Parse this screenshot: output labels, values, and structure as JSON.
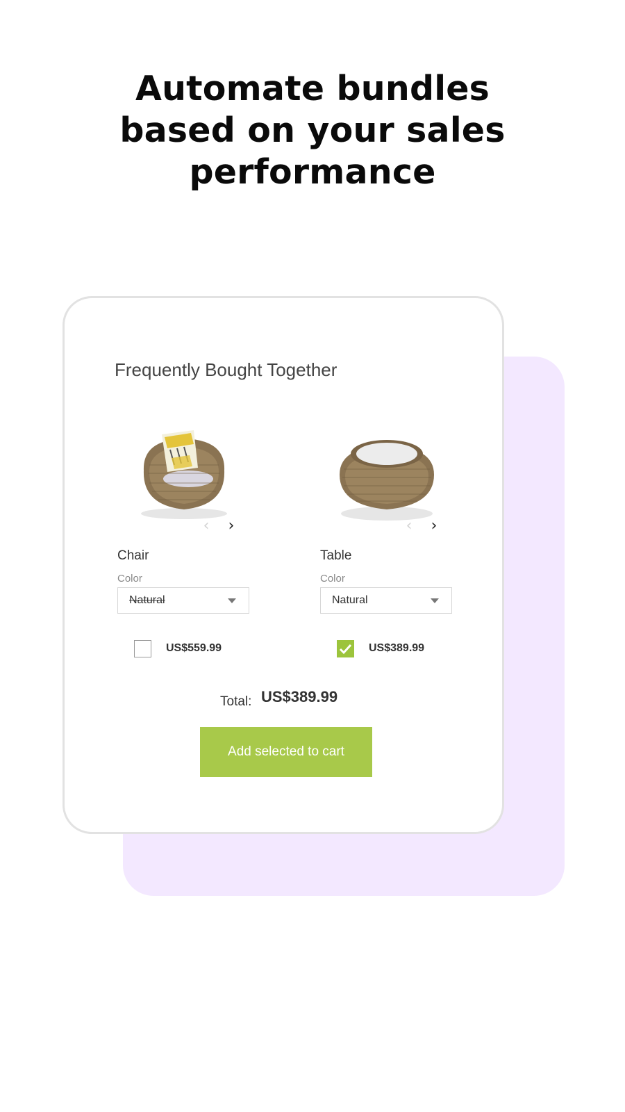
{
  "headline": {
    "line1": "Automate bundles",
    "line2": "based on your sales",
    "line3": "performance"
  },
  "widget": {
    "title": "Frequently Bought Together",
    "products": [
      {
        "name": "Chair",
        "image_icon": "wicker-chair-image",
        "color_label": "Color",
        "color_value": "Natural",
        "color_value_strikethrough": true,
        "checked": false,
        "price": "US$559.99"
      },
      {
        "name": "Table",
        "image_icon": "wicker-table-image",
        "color_label": "Color",
        "color_value": "Natural",
        "color_value_strikethrough": false,
        "checked": true,
        "price": "US$389.99"
      }
    ],
    "total_label": "Total:",
    "total_value": "US$389.99",
    "add_button_label": "Add selected to cart"
  },
  "colors": {
    "accent_green": "#a8c94a",
    "checkbox_green": "#9cc43c",
    "purple_background": "#f3e8ff",
    "card_border": "#e2e2e2"
  }
}
